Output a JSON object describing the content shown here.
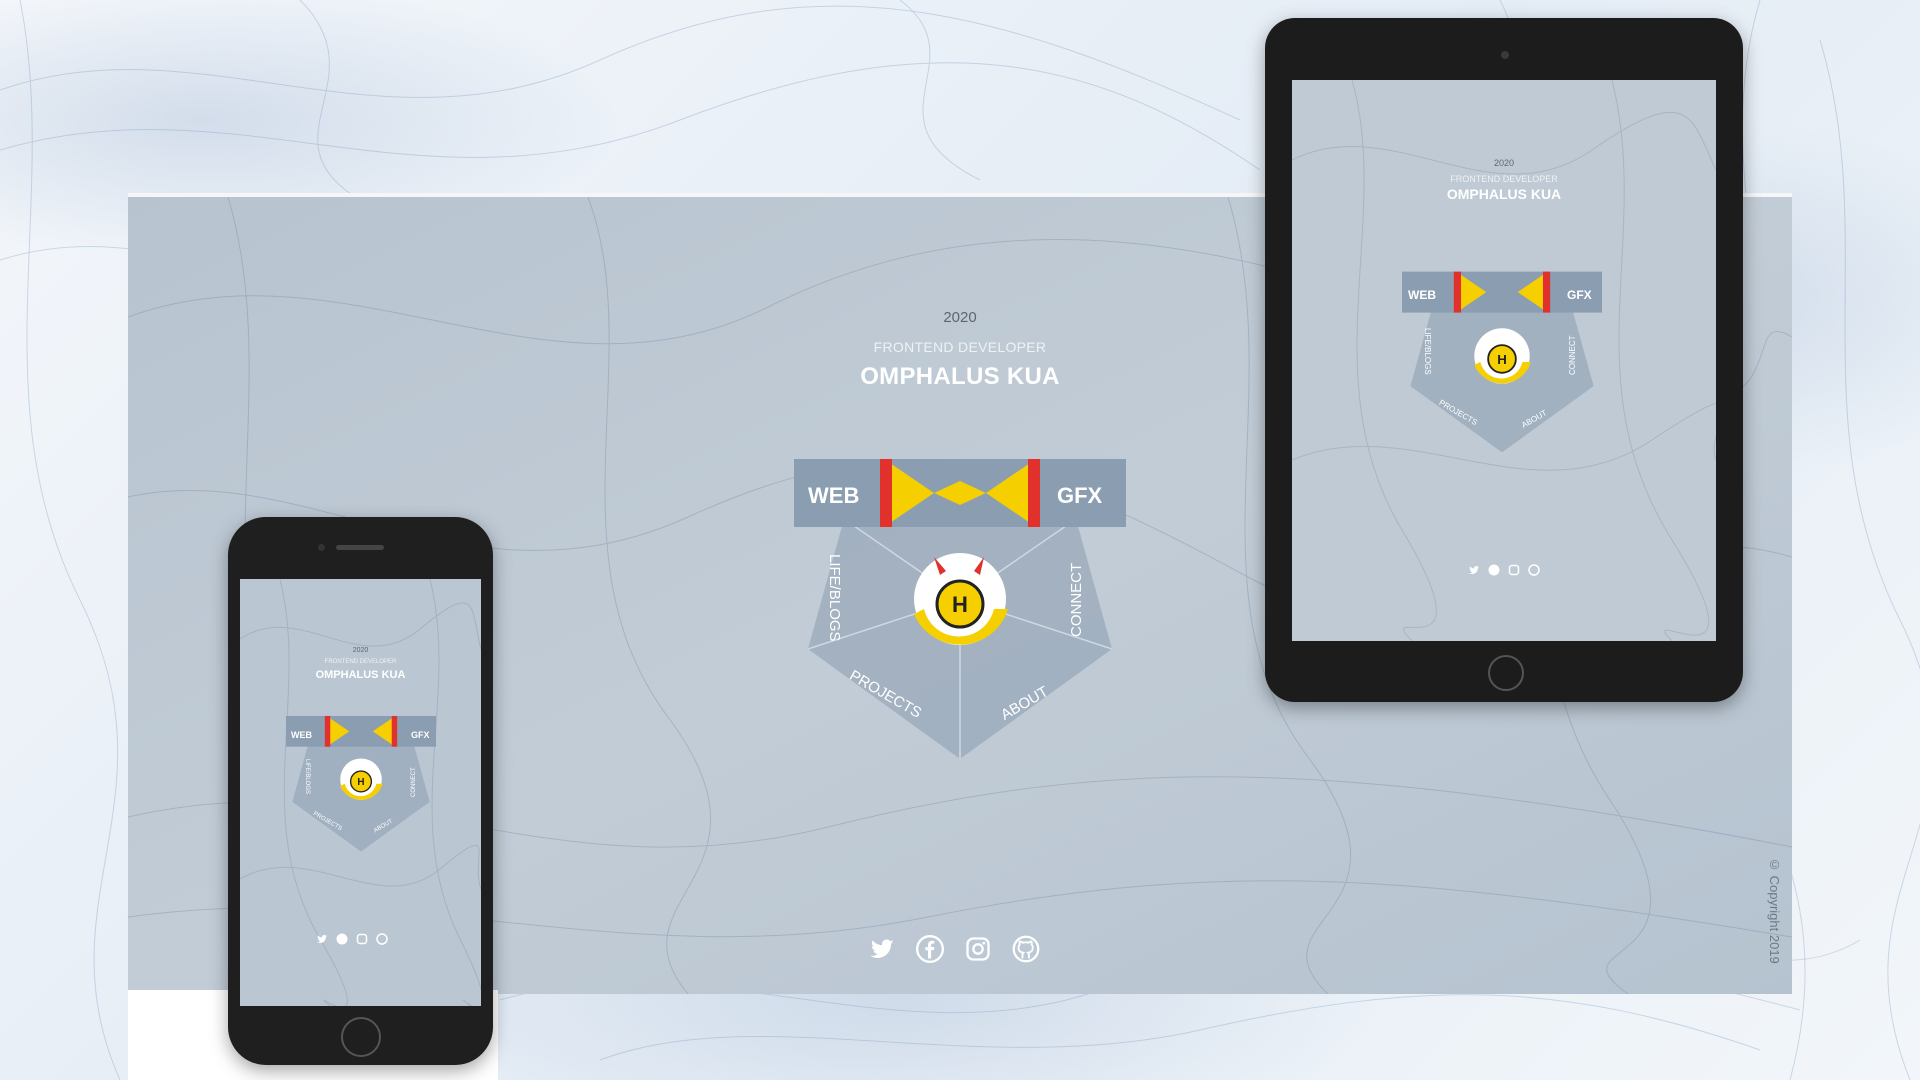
{
  "colors": {
    "panel": "#8e9fb2",
    "yellow": "#f5cf00",
    "red": "#e0312d",
    "text_light": "#ffffff"
  },
  "desktop": {
    "year": "2020",
    "role": "FRONTEND DEVELOPER",
    "name": "OMPHALUS KUA",
    "nav": {
      "web": "WEB",
      "gfx": "GFX",
      "life_blogs": "LIFE/BLOGS",
      "connect": "CONNECT",
      "projects": "PROJECTS",
      "about": "ABOUT"
    },
    "social_icons": [
      "twitter-icon",
      "facebook-icon",
      "instagram-icon",
      "github-icon"
    ],
    "copyright": "© Copyright 2019"
  },
  "tablet": {
    "year": "2020",
    "role": "FRONTEND DEVELOPER",
    "name": "OMPHALUS KUA",
    "nav": {
      "web": "WEB",
      "gfx": "GFX",
      "life_blogs": "LIFE/BLOGS",
      "connect": "CONNECT",
      "projects": "PROJECTS",
      "about": "ABOUT"
    }
  },
  "phone": {
    "year": "2020",
    "role": "FRONTEND DEVELOPER",
    "name": "OMPHALUS KUA",
    "nav": {
      "web": "WEB",
      "gfx": "GFX",
      "life_blogs": "LIFE/BLOGS",
      "connect": "CONNECT",
      "projects": "PROJECTS",
      "about": "ABOUT"
    }
  }
}
